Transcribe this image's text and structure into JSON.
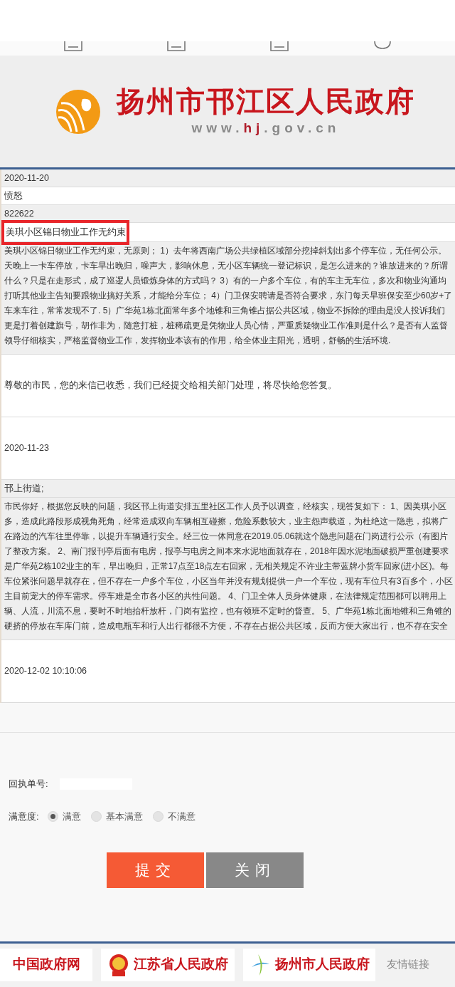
{
  "header": {
    "title": "扬州市邗江区人民政府",
    "url_prefix": "www.",
    "url_highlight": "hj",
    "url_suffix": ".gov.cn"
  },
  "rows": [
    {
      "kind": "line",
      "text": "2020-11-20",
      "shade": true
    },
    {
      "kind": "line",
      "text": "愤怒",
      "shade": false
    },
    {
      "kind": "line",
      "text": "822622",
      "shade": true
    },
    {
      "kind": "title",
      "text": "美琪小区锦日物业工作无约束",
      "shade": false,
      "highlighted": true
    },
    {
      "kind": "para",
      "shade": true,
      "lines": [
        "美琪小区锦日物业工作无约束，无原则； 1）去年将西南广场公共绿植区域部分挖掉斜划出多个停车位，无任何公示。",
        "天晚上一卡车停放，卡车早出晚归，噪声大，影响休息，无小区车辆统一登记标识，是怎么进来的？谁放进来的？所谓",
        "什么？只是在走形式，成了巡逻人员锻炼身体的方式吗？ 3）有的一户多个车位，有的车主无车位，多次和物业沟通均",
        "打听其他业主告知要跟物业搞好关系，才能给分车位； 4）门卫保安聘请是否符合要求，东门每天早班保安至少60岁+了",
        "车来车往，常常发现不了. 5）广华苑1栋北面常年多个地锥和三角锥占据公共区域，物业不拆除的理由是没人投诉我们",
        "更是打着创建旗号，胡作非为，随意打桩，桩稀疏更是凭物业人员心情，严重质疑物业工作准则是什么？是否有人监督",
        "领导仔细核实，严格监督物业工作，发挥物业本该有的作用，给全体业主阳光，透明，舒畅的生活环境."
      ]
    },
    {
      "kind": "tall",
      "text": "尊敬的市民，您的来信已收悉，我们已经提交给相关部门处理，将尽快给您答复。",
      "shade": false
    },
    {
      "kind": "tall",
      "text": "2020-11-23",
      "shade": false
    },
    {
      "kind": "line",
      "text": "邗上街道;",
      "shade": true
    },
    {
      "kind": "para",
      "shade": true,
      "lines": [
        "市民你好，根据您反映的问题，我区邗上街道安排五里社区工作人员予以调查，经核实，现答复如下： 1、因美琪小区",
        "多，造成此路段形成视角死角，经常造成双向车辆相互碰擦，危险系数较大，业主怨声载道，为杜绝这一隐患，拟将广",
        "在路边的汽车往里停靠，以提升车辆通行安全。经三位一体同意在2019.05.06就这个隐患问题在门岗进行公示（有图片",
        "了整改方案。 2、南门报刊亭后面有电房，报亭与电房之间本来水泥地面就存在，2018年因水泥地面破损严重创建要求",
        "是广华苑2栋102业主的车，早出晚归，正常17点至18点左右回家，无相关规定不许业主带蓝牌小货车回家(进小区)。每",
        "车位紧张问题早就存在，但不存在一户多个车位，小区当年并没有规划提供一户一个车位，现有车位只有3百多个，小区",
        "主目前宠大的停车需求。停车难是全市各小区的共性问题。 4、门卫全体人员身体健康，在法律规定范围都可以聘用上",
        "辆、人流，川流不息，要时不时地抬杆放杆，门岗有监控，也有领班不定时的督查。 5、广华苑1栋北面地锥和三角锥的",
        "硬挤的停放在车库门前，造成电瓶车和行人出行都很不方便，不存在占据公共区域，反而方便大家出行，也不存在安全"
      ]
    },
    {
      "kind": "tall",
      "text": "2020-12-02 10:10:06",
      "shade": false
    }
  ],
  "form": {
    "receipt_label": "回执单号:",
    "satisfaction_label": "满意度:",
    "options": [
      {
        "label": "满意",
        "selected": true
      },
      {
        "label": "基本满意",
        "selected": false
      },
      {
        "label": "不满意",
        "selected": false
      }
    ],
    "submit": "提交",
    "close": "关闭"
  },
  "footer_links": [
    {
      "kind": "plain",
      "label": "中国政府网"
    },
    {
      "kind": "emblem",
      "label": "江苏省人民政府"
    },
    {
      "kind": "logo",
      "label": "扬州市人民政府"
    },
    {
      "kind": "more",
      "label": "友情链接"
    }
  ]
}
